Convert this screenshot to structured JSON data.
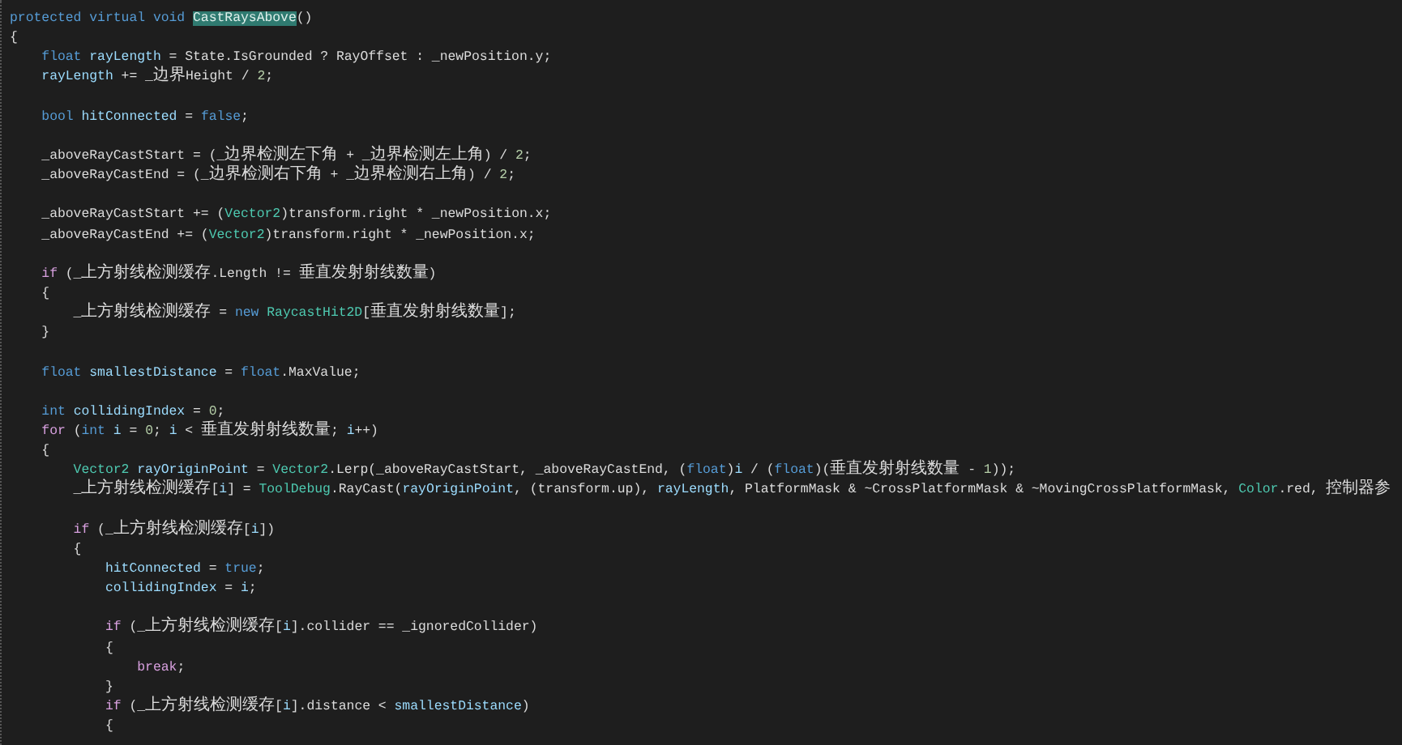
{
  "editor": {
    "lines": [
      {
        "kind": "code",
        "tokens": [
          {
            "kind": "keyword",
            "text": "protected virtual void "
          },
          {
            "kind": "selected",
            "text": "CastRaysAbove"
          },
          {
            "kind": "plain",
            "text": "()"
          }
        ]
      },
      {
        "kind": "code",
        "tokens": [
          {
            "kind": "plain",
            "text": "{"
          }
        ]
      },
      {
        "kind": "code",
        "tokens": [
          {
            "kind": "keyword",
            "text": "    float "
          },
          {
            "kind": "variable",
            "text": "rayLength"
          },
          {
            "kind": "plain",
            "text": " = State.IsGrounded ? RayOffset : _newPosition.y;"
          }
        ]
      },
      {
        "kind": "code",
        "tokens": [
          {
            "kind": "variable",
            "text": "    rayLength"
          },
          {
            "kind": "plain",
            "text": " += _边界Height / "
          },
          {
            "kind": "number",
            "text": "2"
          },
          {
            "kind": "plain",
            "text": ";"
          }
        ]
      },
      {
        "kind": "blank"
      },
      {
        "kind": "code",
        "tokens": [
          {
            "kind": "keyword",
            "text": "    bool "
          },
          {
            "kind": "variable",
            "text": "hitConnected"
          },
          {
            "kind": "plain",
            "text": " = "
          },
          {
            "kind": "keyword",
            "text": "false"
          },
          {
            "kind": "plain",
            "text": ";"
          }
        ]
      },
      {
        "kind": "blank"
      },
      {
        "kind": "code",
        "tokens": [
          {
            "kind": "plain",
            "text": "    _aboveRayCastStart = (_边界检测左下角 + _边界检测左上角) / "
          },
          {
            "kind": "number",
            "text": "2"
          },
          {
            "kind": "plain",
            "text": ";"
          }
        ]
      },
      {
        "kind": "code",
        "tokens": [
          {
            "kind": "plain",
            "text": "    _aboveRayCastEnd = (_边界检测右下角 + _边界检测右上角) / "
          },
          {
            "kind": "number",
            "text": "2"
          },
          {
            "kind": "plain",
            "text": ";"
          }
        ]
      },
      {
        "kind": "blank"
      },
      {
        "kind": "code",
        "tokens": [
          {
            "kind": "plain",
            "text": "    _aboveRayCastStart += ("
          },
          {
            "kind": "type",
            "text": "Vector2"
          },
          {
            "kind": "plain",
            "text": ")transform.right * _newPosition.x;"
          }
        ]
      },
      {
        "kind": "code",
        "tokens": [
          {
            "kind": "plain",
            "text": "    _aboveRayCastEnd += ("
          },
          {
            "kind": "type",
            "text": "Vector2"
          },
          {
            "kind": "plain",
            "text": ")transform.right * _newPosition.x;"
          }
        ]
      },
      {
        "kind": "blank"
      },
      {
        "kind": "code",
        "tokens": [
          {
            "kind": "control",
            "text": "    if"
          },
          {
            "kind": "plain",
            "text": " (_上方射线检测缓存.Length != 垂直发射射线数量)"
          }
        ]
      },
      {
        "kind": "code",
        "tokens": [
          {
            "kind": "plain",
            "text": "    {"
          }
        ]
      },
      {
        "kind": "code",
        "tokens": [
          {
            "kind": "plain",
            "text": "        _上方射线检测缓存 = "
          },
          {
            "kind": "keyword",
            "text": "new "
          },
          {
            "kind": "type",
            "text": "RaycastHit2D"
          },
          {
            "kind": "plain",
            "text": "[垂直发射射线数量];"
          }
        ]
      },
      {
        "kind": "code",
        "tokens": [
          {
            "kind": "plain",
            "text": "    }"
          }
        ]
      },
      {
        "kind": "blank"
      },
      {
        "kind": "code",
        "tokens": [
          {
            "kind": "keyword",
            "text": "    float "
          },
          {
            "kind": "variable",
            "text": "smallestDistance"
          },
          {
            "kind": "plain",
            "text": " = "
          },
          {
            "kind": "keyword",
            "text": "float"
          },
          {
            "kind": "plain",
            "text": ".MaxValue;"
          }
        ]
      },
      {
        "kind": "blank"
      },
      {
        "kind": "code",
        "tokens": [
          {
            "kind": "keyword",
            "text": "    int "
          },
          {
            "kind": "variable",
            "text": "collidingIndex"
          },
          {
            "kind": "plain",
            "text": " = "
          },
          {
            "kind": "number",
            "text": "0"
          },
          {
            "kind": "plain",
            "text": ";"
          }
        ]
      },
      {
        "kind": "code",
        "tokens": [
          {
            "kind": "control",
            "text": "    for"
          },
          {
            "kind": "plain",
            "text": " ("
          },
          {
            "kind": "keyword",
            "text": "int "
          },
          {
            "kind": "variable",
            "text": "i"
          },
          {
            "kind": "plain",
            "text": " = "
          },
          {
            "kind": "number",
            "text": "0"
          },
          {
            "kind": "plain",
            "text": "; "
          },
          {
            "kind": "variable",
            "text": "i"
          },
          {
            "kind": "plain",
            "text": " < 垂直发射射线数量; "
          },
          {
            "kind": "variable",
            "text": "i"
          },
          {
            "kind": "plain",
            "text": "++)"
          }
        ]
      },
      {
        "kind": "code",
        "tokens": [
          {
            "kind": "plain",
            "text": "    {"
          }
        ]
      },
      {
        "kind": "code",
        "tokens": [
          {
            "kind": "type",
            "text": "        Vector2 "
          },
          {
            "kind": "variable",
            "text": "rayOriginPoint"
          },
          {
            "kind": "plain",
            "text": " = "
          },
          {
            "kind": "type",
            "text": "Vector2"
          },
          {
            "kind": "plain",
            "text": ".Lerp(_aboveRayCastStart, _aboveRayCastEnd, ("
          },
          {
            "kind": "keyword",
            "text": "float"
          },
          {
            "kind": "plain",
            "text": ")"
          },
          {
            "kind": "variable",
            "text": "i"
          },
          {
            "kind": "plain",
            "text": " / ("
          },
          {
            "kind": "keyword",
            "text": "float"
          },
          {
            "kind": "plain",
            "text": ")(垂直发射射线数量 - "
          },
          {
            "kind": "number",
            "text": "1"
          },
          {
            "kind": "plain",
            "text": "));"
          }
        ]
      },
      {
        "kind": "code",
        "tokens": [
          {
            "kind": "plain",
            "text": "        _上方射线检测缓存["
          },
          {
            "kind": "variable",
            "text": "i"
          },
          {
            "kind": "plain",
            "text": "] = "
          },
          {
            "kind": "type",
            "text": "ToolDebug"
          },
          {
            "kind": "plain",
            "text": ".RayCast("
          },
          {
            "kind": "variable",
            "text": "rayOriginPoint"
          },
          {
            "kind": "plain",
            "text": ", (transform.up), "
          },
          {
            "kind": "variable",
            "text": "rayLength"
          },
          {
            "kind": "plain",
            "text": ", PlatformMask & ~CrossPlatformMask & ~MovingCrossPlatformMask, "
          },
          {
            "kind": "type",
            "text": "Color"
          },
          {
            "kind": "plain",
            "text": ".red, 控制器参"
          }
        ]
      },
      {
        "kind": "blank"
      },
      {
        "kind": "code",
        "tokens": [
          {
            "kind": "control",
            "text": "        if"
          },
          {
            "kind": "plain",
            "text": " (_上方射线检测缓存["
          },
          {
            "kind": "variable",
            "text": "i"
          },
          {
            "kind": "plain",
            "text": "])"
          }
        ]
      },
      {
        "kind": "code",
        "tokens": [
          {
            "kind": "plain",
            "text": "        {"
          }
        ]
      },
      {
        "kind": "code",
        "tokens": [
          {
            "kind": "variable",
            "text": "            hitConnected"
          },
          {
            "kind": "plain",
            "text": " = "
          },
          {
            "kind": "keyword",
            "text": "true"
          },
          {
            "kind": "plain",
            "text": ";"
          }
        ]
      },
      {
        "kind": "code",
        "tokens": [
          {
            "kind": "variable",
            "text": "            collidingIndex"
          },
          {
            "kind": "plain",
            "text": " = "
          },
          {
            "kind": "variable",
            "text": "i"
          },
          {
            "kind": "plain",
            "text": ";"
          }
        ]
      },
      {
        "kind": "blank"
      },
      {
        "kind": "code",
        "tokens": [
          {
            "kind": "control",
            "text": "            if"
          },
          {
            "kind": "plain",
            "text": " (_上方射线检测缓存["
          },
          {
            "kind": "variable",
            "text": "i"
          },
          {
            "kind": "plain",
            "text": "].collider == _ignoredCollider)"
          }
        ]
      },
      {
        "kind": "code",
        "tokens": [
          {
            "kind": "plain",
            "text": "            {"
          }
        ]
      },
      {
        "kind": "code",
        "tokens": [
          {
            "kind": "control",
            "text": "                break"
          },
          {
            "kind": "plain",
            "text": ";"
          }
        ]
      },
      {
        "kind": "code",
        "tokens": [
          {
            "kind": "plain",
            "text": "            }"
          }
        ]
      },
      {
        "kind": "code",
        "tokens": [
          {
            "kind": "control",
            "text": "            if"
          },
          {
            "kind": "plain",
            "text": " (_上方射线检测缓存["
          },
          {
            "kind": "variable",
            "text": "i"
          },
          {
            "kind": "plain",
            "text": "].distance < "
          },
          {
            "kind": "variable",
            "text": "smallestDistance"
          },
          {
            "kind": "plain",
            "text": ")"
          }
        ]
      },
      {
        "kind": "code",
        "tokens": [
          {
            "kind": "plain",
            "text": "            {"
          }
        ]
      }
    ]
  }
}
